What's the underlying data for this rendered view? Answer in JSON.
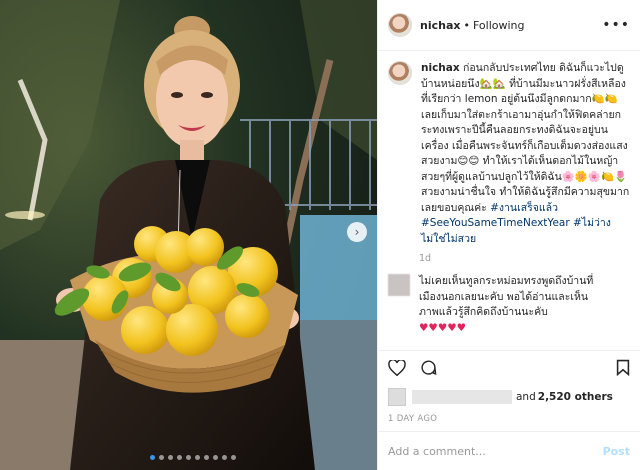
{
  "header": {
    "username": "nichax",
    "separator": "•",
    "follow_label": "Following",
    "more": "•••"
  },
  "caption": {
    "username": "nichax",
    "text": "ก่อนกลับประเทศไทย ดิฉันก็แวะไปดูบ้านหน่อยนึง🏡🏡 ที่บ้านมีมะนาวฝรั่งสีเหลืองที่เรียกว่า lemon อยู่ต้นนึงมีลูกดกมาก🍋🍋 เลยเก็บมาใส่ตะกร้าเอามาอุ่นกำให้ฟิดคล่ายกระทงเพราะปีนี้คืนลอยกระทงดิฉันจะอยู่บนเครื่อง เมื่อคืนพระจันทร์ก็เกือบเต็มดวงส่องแสงสวยงาม😊😊 ทำให้เราได้เห็นดอกไม้ในหญ้าสวยๆที่ผู้ดูแลบ้านปลูกไว้ให้ดิฉัน🌸🌼🌸🍋🌷 สวยงามน่าชื่นใจ ทำให้ดิฉันรู้สึกมีความสุขมากเลยขอบคุณค่ะ",
    "hashtags": "#งานเสร็จแล้ว #SeeYouSameTimeNextYear #ไม่ว่างไม่ใช่ไม่สวย",
    "age": "1d"
  },
  "comment": {
    "text": "ไม่เคยเห็นทูลกระหม่อมทรงพูดถึงบ้านที่เมืองนอกเลยนะคับ พอได้อ่านและเห็นภาพแล้วรู้สึกคิดถึงบ้านนะคับ",
    "hearts": "♥♥♥♥♥"
  },
  "actions": {
    "like_icon": "heart-outline",
    "comment_icon": "speech-bubble",
    "save_icon": "bookmark"
  },
  "likes": {
    "joiner": "and",
    "count": "2,520 others"
  },
  "date": "1 DAY AGO",
  "add_comment": {
    "placeholder": "Add a comment...",
    "post_label": "Post"
  },
  "media": {
    "arrow": "›",
    "dots_total": 10,
    "dots_active": 0
  }
}
